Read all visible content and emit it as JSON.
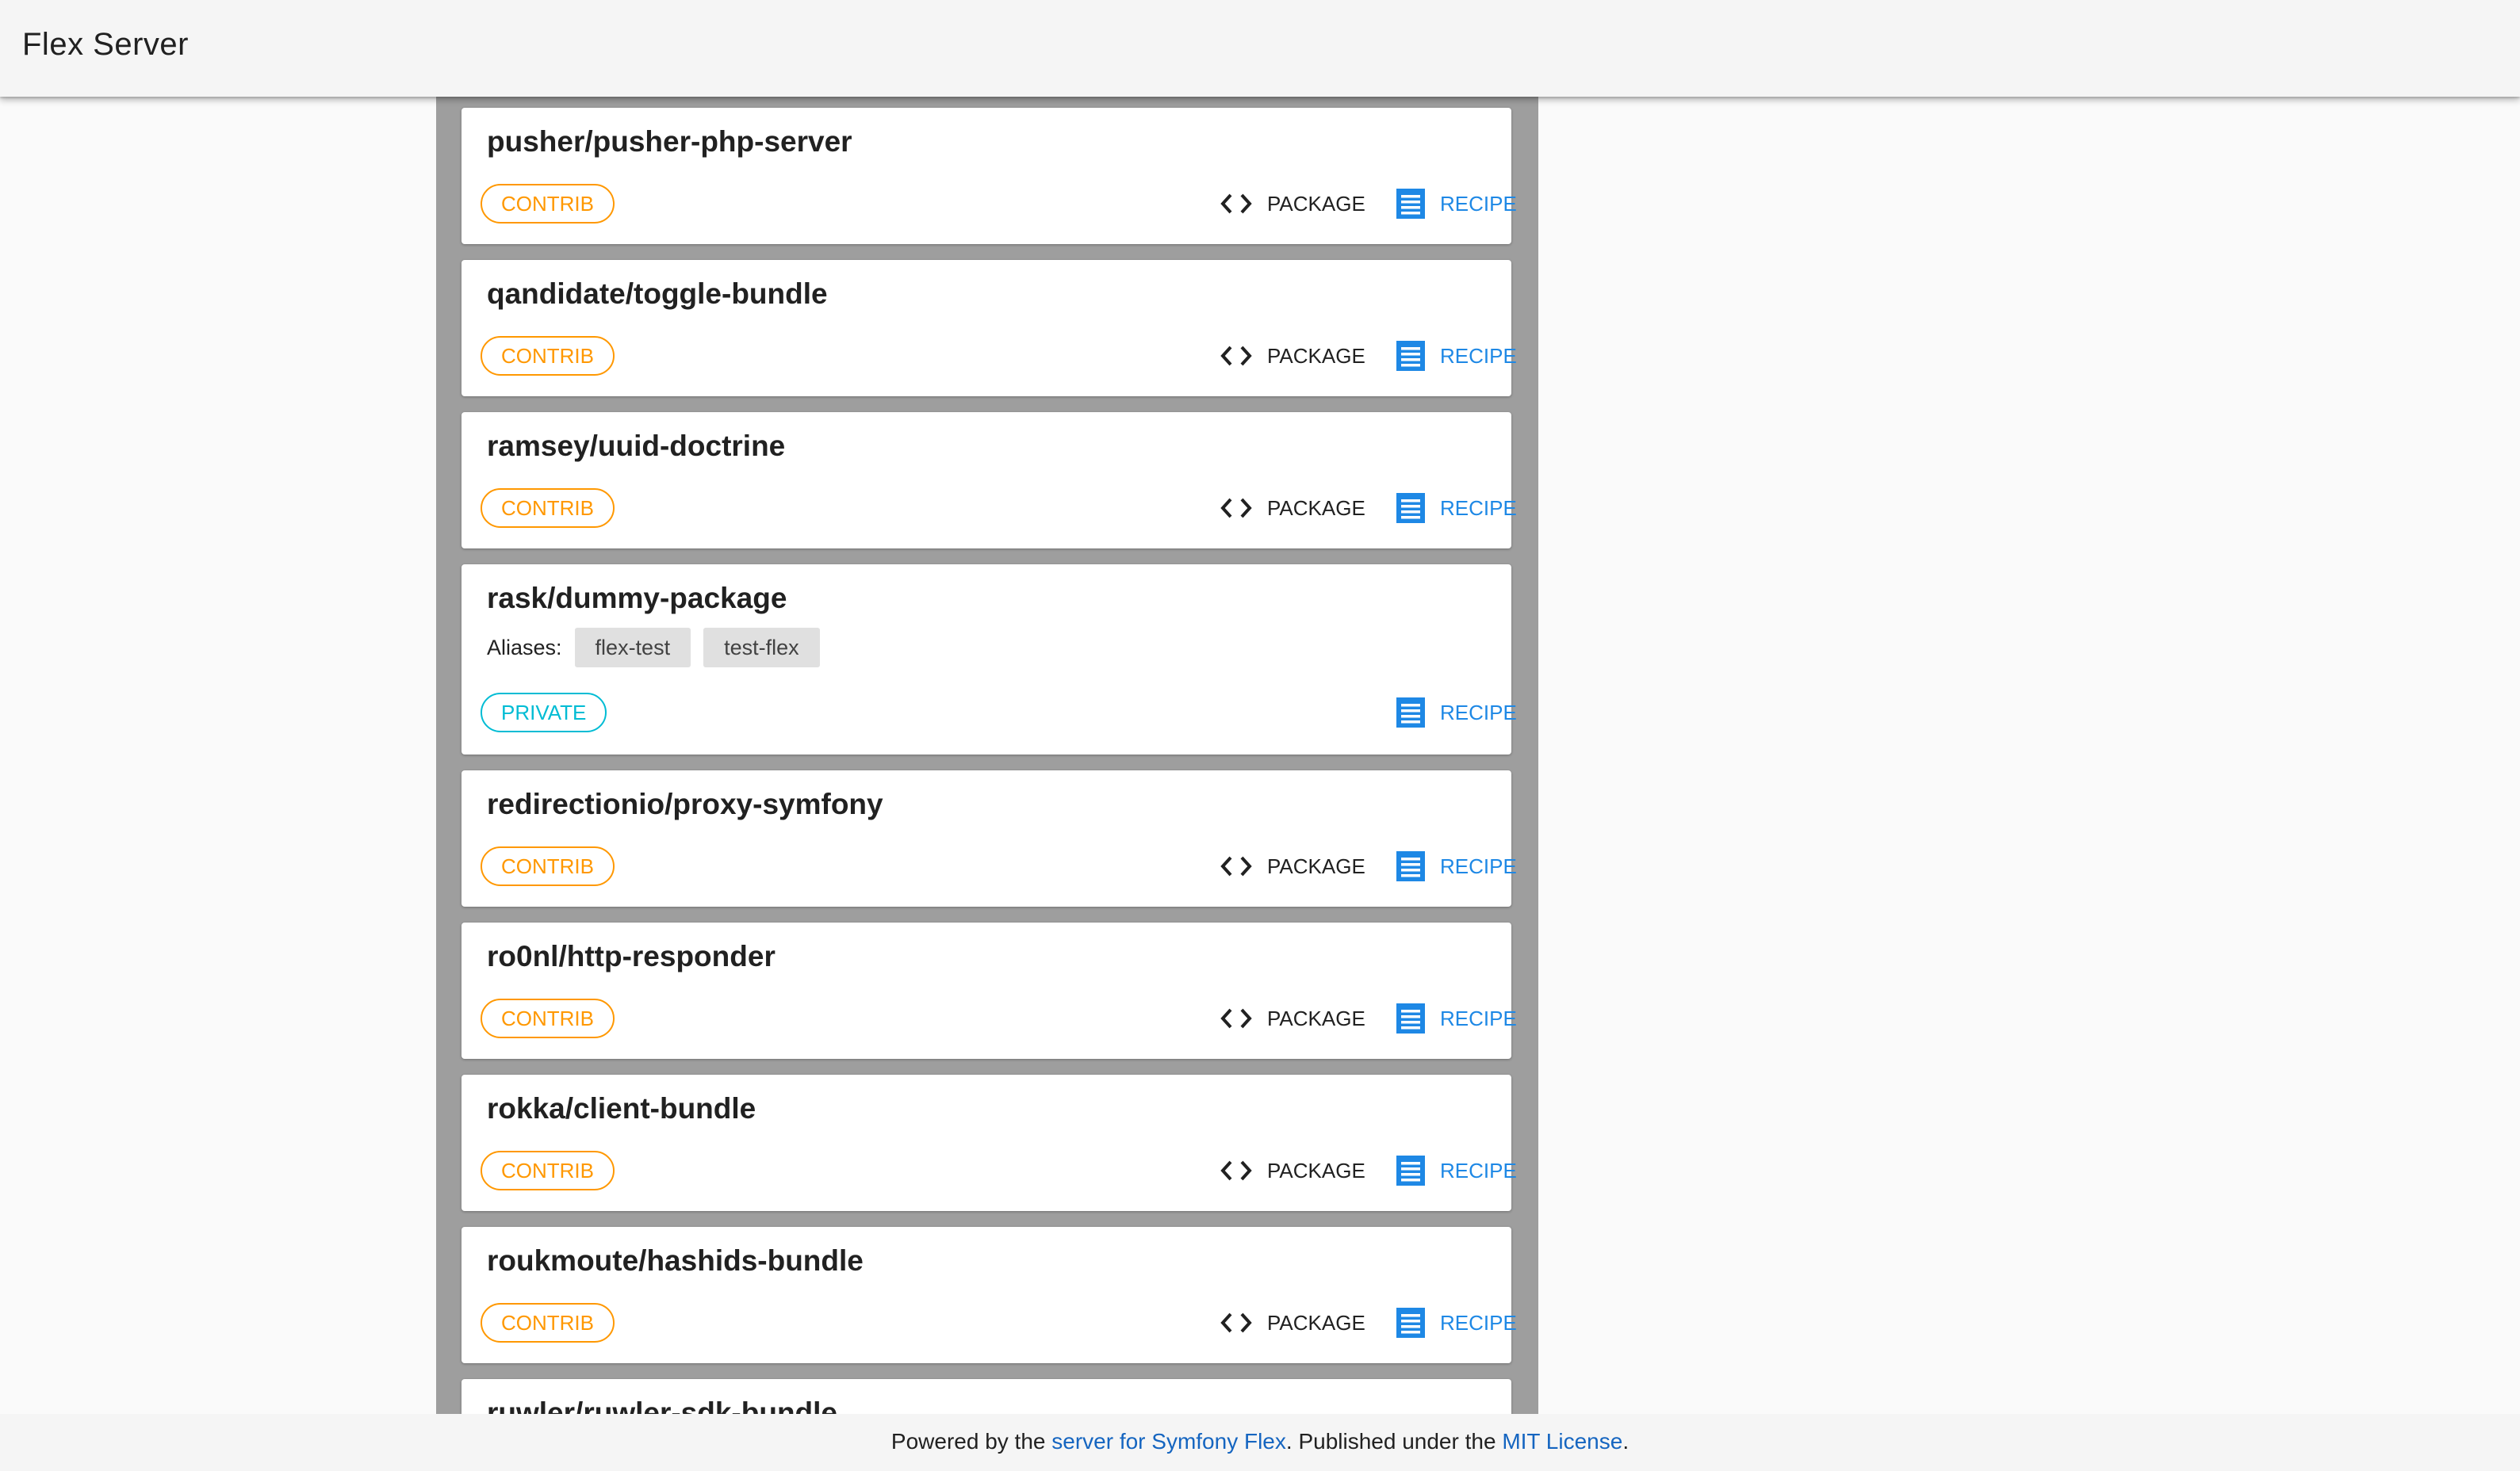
{
  "app": {
    "title": "Flex Server"
  },
  "labels": {
    "package": "PACKAGE",
    "recipe": "RECIPE",
    "aliases": "Aliases:"
  },
  "packages": [
    {
      "name": "pusher/pusher-php-server",
      "badge": "CONTRIB",
      "has_package_link": true
    },
    {
      "name": "qandidate/toggle-bundle",
      "badge": "CONTRIB",
      "has_package_link": true
    },
    {
      "name": "ramsey/uuid-doctrine",
      "badge": "CONTRIB",
      "has_package_link": true
    },
    {
      "name": "rask/dummy-package",
      "badge": "PRIVATE",
      "has_package_link": false,
      "aliases": [
        "flex-test",
        "test-flex"
      ]
    },
    {
      "name": "redirectionio/proxy-symfony",
      "badge": "CONTRIB",
      "has_package_link": true
    },
    {
      "name": "ro0nl/http-responder",
      "badge": "CONTRIB",
      "has_package_link": true
    },
    {
      "name": "rokka/client-bundle",
      "badge": "CONTRIB",
      "has_package_link": true
    },
    {
      "name": "roukmoute/hashids-bundle",
      "badge": "CONTRIB",
      "has_package_link": true
    },
    {
      "name": "ruwler/ruwler-sdk-bundle",
      "badge": "",
      "has_package_link": true
    }
  ],
  "colors": {
    "contrib": "#ff9800",
    "private": "#00bcd4",
    "recipe": "#1e88e5",
    "link": "#1565c0",
    "list_background": "#9e9e9e"
  },
  "icons": {
    "package": "code-brackets-icon",
    "recipe": "recipe-document-icon"
  },
  "footer": {
    "text_1": "Powered by the ",
    "link_1": "server for Symfony Flex",
    "text_2": ". Published under the ",
    "link_2": "MIT License",
    "text_3": "."
  }
}
